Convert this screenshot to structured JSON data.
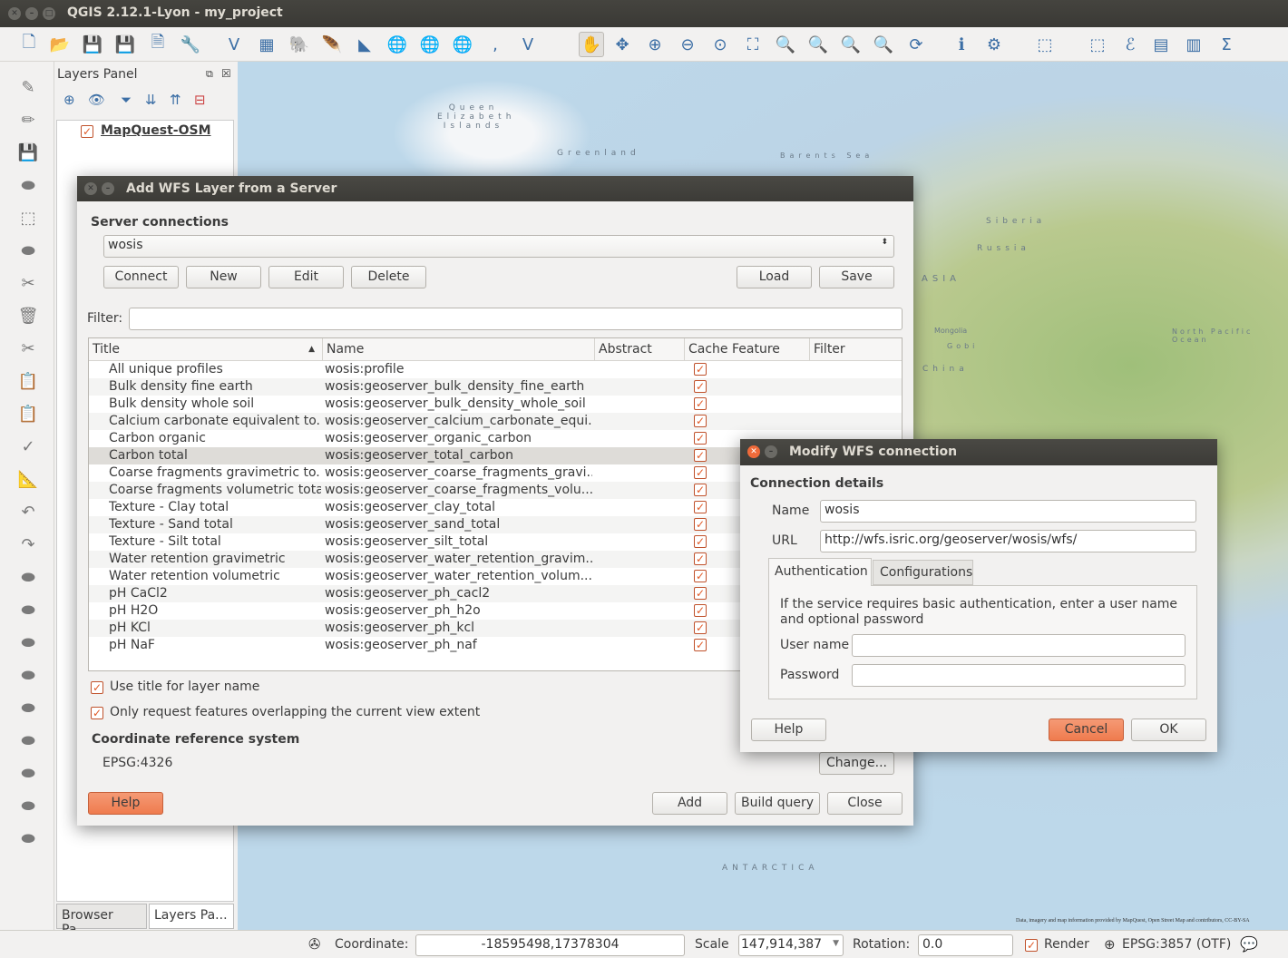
{
  "window": {
    "title": "QGIS 2.12.1-Lyon - my_project"
  },
  "toolbar": {
    "icons": [
      "new-project",
      "open-project",
      "save-project",
      "save-as",
      "new-print-composer",
      "composer-manager",
      "add-vector-layer",
      "add-raster-layer",
      "add-postgis-layer",
      "add-spatialite-layer",
      "add-mssql-layer",
      "add-wms-layer",
      "add-wcs-layer",
      "add-wfs-layer",
      "add-delimited-text-layer",
      "new-shapefile-layer",
      "pan",
      "pan-to-selection",
      "zoom-in",
      "zoom-out",
      "zoom-native",
      "zoom-full",
      "zoom-to-selection",
      "zoom-to-layer",
      "zoom-last",
      "zoom-next",
      "refresh",
      "identify",
      "action",
      "select",
      "deselect",
      "field-calculator",
      "attribute-table",
      "statistics",
      "sum"
    ]
  },
  "layers_panel": {
    "title": "Layers Panel",
    "layer": "MapQuest-OSM",
    "tabs": [
      "Browser Pa...",
      "Layers Pa..."
    ]
  },
  "map": {
    "labels": [
      "Queen Elizabeth Islands",
      "Greenland",
      "Barents Sea",
      "Siberia",
      "Russia",
      "ASIA",
      "Mongolia",
      "Gobi",
      "China",
      "North Pacific Ocean",
      "ANTARCTICA"
    ],
    "attribution": "Data, imagery and map information provided by MapQuest, Open Street Map and contributors, CC-BY-SA"
  },
  "status": {
    "coordinate_label": "Coordinate:",
    "coordinate": "-18595498,17378304",
    "scale_label": "Scale",
    "scale": "147,914,387",
    "rotation_label": "Rotation:",
    "rotation": "0.0",
    "render_label": "Render",
    "crs": "EPSG:3857 (OTF)"
  },
  "wfs": {
    "title": "Add WFS Layer from a Server",
    "server_connections": "Server connections",
    "connection": "wosis",
    "buttons": {
      "connect": "Connect",
      "new": "New",
      "edit": "Edit",
      "delete": "Delete",
      "load": "Load",
      "save": "Save",
      "change": "Change...",
      "help": "Help",
      "add": "Add",
      "build_query": "Build query",
      "close": "Close"
    },
    "filter_label": "Filter:",
    "filter_value": "",
    "columns": [
      "Title",
      "Name",
      "Abstract",
      "Cache Feature",
      "Filter"
    ],
    "rows": [
      {
        "title": "All unique profiles",
        "name": "wosis:profile",
        "cache": true
      },
      {
        "title": "Bulk density fine earth",
        "name": "wosis:geoserver_bulk_density_fine_earth",
        "cache": true
      },
      {
        "title": "Bulk density whole soil",
        "name": "wosis:geoserver_bulk_density_whole_soil",
        "cache": true
      },
      {
        "title": "Calcium carbonate equivalent to...",
        "name": "wosis:geoserver_calcium_carbonate_equi...",
        "cache": true
      },
      {
        "title": "Carbon organic",
        "name": "wosis:geoserver_organic_carbon",
        "cache": true
      },
      {
        "title": "Carbon total",
        "name": "wosis:geoserver_total_carbon",
        "cache": true,
        "selected": true
      },
      {
        "title": "Coarse fragments gravimetric to...",
        "name": "wosis:geoserver_coarse_fragments_gravi...",
        "cache": true
      },
      {
        "title": "Coarse fragments volumetric total",
        "name": "wosis:geoserver_coarse_fragments_volu...",
        "cache": true
      },
      {
        "title": "Texture - Clay total",
        "name": "wosis:geoserver_clay_total",
        "cache": true
      },
      {
        "title": "Texture - Sand total",
        "name": "wosis:geoserver_sand_total",
        "cache": true
      },
      {
        "title": "Texture - Silt total",
        "name": "wosis:geoserver_silt_total",
        "cache": true
      },
      {
        "title": "Water retention gravimetric",
        "name": "wosis:geoserver_water_retention_gravim...",
        "cache": true
      },
      {
        "title": "Water retention volumetric",
        "name": "wosis:geoserver_water_retention_volum...",
        "cache": true
      },
      {
        "title": "pH CaCl2",
        "name": "wosis:geoserver_ph_cacl2",
        "cache": true
      },
      {
        "title": "pH H2O",
        "name": "wosis:geoserver_ph_h2o",
        "cache": true
      },
      {
        "title": "pH KCl",
        "name": "wosis:geoserver_ph_kcl",
        "cache": true
      },
      {
        "title": "pH NaF",
        "name": "wosis:geoserver_ph_naf",
        "cache": true
      }
    ],
    "use_title": "Use title for layer name",
    "only_request": "Only request features overlapping the current view extent",
    "crs_heading": "Coordinate reference system",
    "crs": "EPSG:4326"
  },
  "modify": {
    "title": "Modify WFS connection",
    "heading": "Connection details",
    "name_label": "Name",
    "name": "wosis",
    "url_label": "URL",
    "url": "http://wfs.isric.org/geoserver/wosis/wfs/",
    "tabs": [
      "Authentication",
      "Configurations"
    ],
    "auth_text": "If the service requires basic authentication, enter a user name and optional password",
    "user_label": "User name",
    "user": "",
    "password_label": "Password",
    "password": "",
    "help": "Help",
    "cancel": "Cancel",
    "ok": "OK"
  },
  "colors": {
    "accent": "#ef7b4e",
    "titlebar": "#3c3b37",
    "check": "#e05a27"
  }
}
